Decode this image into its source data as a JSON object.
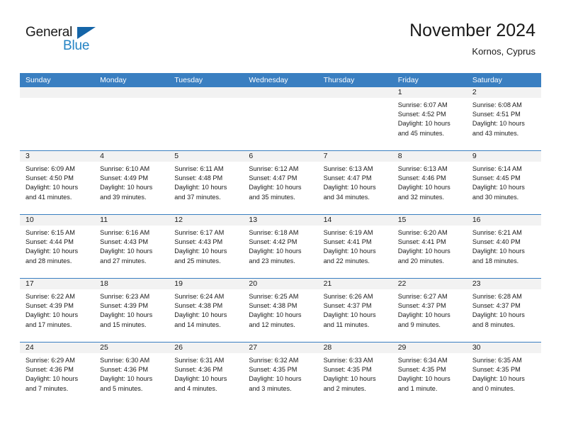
{
  "brand": {
    "name_part1": "General",
    "name_part2": "Blue",
    "accent_color": "#2383c4",
    "triangle_color": "#1565a8"
  },
  "header": {
    "title": "November 2024",
    "subtitle": "Kornos, Cyprus"
  },
  "theme": {
    "header_blue": "#3a7fc1",
    "number_band": "#f2f2f2",
    "text": "#1a1a1a"
  },
  "calendar": {
    "day_headers": [
      "Sunday",
      "Monday",
      "Tuesday",
      "Wednesday",
      "Thursday",
      "Friday",
      "Saturday"
    ],
    "weeks": [
      {
        "days": [
          {
            "number": "",
            "sunrise": "",
            "sunset": "",
            "daylight_line1": "",
            "daylight_line2": ""
          },
          {
            "number": "",
            "sunrise": "",
            "sunset": "",
            "daylight_line1": "",
            "daylight_line2": ""
          },
          {
            "number": "",
            "sunrise": "",
            "sunset": "",
            "daylight_line1": "",
            "daylight_line2": ""
          },
          {
            "number": "",
            "sunrise": "",
            "sunset": "",
            "daylight_line1": "",
            "daylight_line2": ""
          },
          {
            "number": "",
            "sunrise": "",
            "sunset": "",
            "daylight_line1": "",
            "daylight_line2": ""
          },
          {
            "number": "1",
            "sunrise": "Sunrise: 6:07 AM",
            "sunset": "Sunset: 4:52 PM",
            "daylight_line1": "Daylight: 10 hours",
            "daylight_line2": "and 45 minutes."
          },
          {
            "number": "2",
            "sunrise": "Sunrise: 6:08 AM",
            "sunset": "Sunset: 4:51 PM",
            "daylight_line1": "Daylight: 10 hours",
            "daylight_line2": "and 43 minutes."
          }
        ]
      },
      {
        "days": [
          {
            "number": "3",
            "sunrise": "Sunrise: 6:09 AM",
            "sunset": "Sunset: 4:50 PM",
            "daylight_line1": "Daylight: 10 hours",
            "daylight_line2": "and 41 minutes."
          },
          {
            "number": "4",
            "sunrise": "Sunrise: 6:10 AM",
            "sunset": "Sunset: 4:49 PM",
            "daylight_line1": "Daylight: 10 hours",
            "daylight_line2": "and 39 minutes."
          },
          {
            "number": "5",
            "sunrise": "Sunrise: 6:11 AM",
            "sunset": "Sunset: 4:48 PM",
            "daylight_line1": "Daylight: 10 hours",
            "daylight_line2": "and 37 minutes."
          },
          {
            "number": "6",
            "sunrise": "Sunrise: 6:12 AM",
            "sunset": "Sunset: 4:47 PM",
            "daylight_line1": "Daylight: 10 hours",
            "daylight_line2": "and 35 minutes."
          },
          {
            "number": "7",
            "sunrise": "Sunrise: 6:13 AM",
            "sunset": "Sunset: 4:47 PM",
            "daylight_line1": "Daylight: 10 hours",
            "daylight_line2": "and 34 minutes."
          },
          {
            "number": "8",
            "sunrise": "Sunrise: 6:13 AM",
            "sunset": "Sunset: 4:46 PM",
            "daylight_line1": "Daylight: 10 hours",
            "daylight_line2": "and 32 minutes."
          },
          {
            "number": "9",
            "sunrise": "Sunrise: 6:14 AM",
            "sunset": "Sunset: 4:45 PM",
            "daylight_line1": "Daylight: 10 hours",
            "daylight_line2": "and 30 minutes."
          }
        ]
      },
      {
        "days": [
          {
            "number": "10",
            "sunrise": "Sunrise: 6:15 AM",
            "sunset": "Sunset: 4:44 PM",
            "daylight_line1": "Daylight: 10 hours",
            "daylight_line2": "and 28 minutes."
          },
          {
            "number": "11",
            "sunrise": "Sunrise: 6:16 AM",
            "sunset": "Sunset: 4:43 PM",
            "daylight_line1": "Daylight: 10 hours",
            "daylight_line2": "and 27 minutes."
          },
          {
            "number": "12",
            "sunrise": "Sunrise: 6:17 AM",
            "sunset": "Sunset: 4:43 PM",
            "daylight_line1": "Daylight: 10 hours",
            "daylight_line2": "and 25 minutes."
          },
          {
            "number": "13",
            "sunrise": "Sunrise: 6:18 AM",
            "sunset": "Sunset: 4:42 PM",
            "daylight_line1": "Daylight: 10 hours",
            "daylight_line2": "and 23 minutes."
          },
          {
            "number": "14",
            "sunrise": "Sunrise: 6:19 AM",
            "sunset": "Sunset: 4:41 PM",
            "daylight_line1": "Daylight: 10 hours",
            "daylight_line2": "and 22 minutes."
          },
          {
            "number": "15",
            "sunrise": "Sunrise: 6:20 AM",
            "sunset": "Sunset: 4:41 PM",
            "daylight_line1": "Daylight: 10 hours",
            "daylight_line2": "and 20 minutes."
          },
          {
            "number": "16",
            "sunrise": "Sunrise: 6:21 AM",
            "sunset": "Sunset: 4:40 PM",
            "daylight_line1": "Daylight: 10 hours",
            "daylight_line2": "and 18 minutes."
          }
        ]
      },
      {
        "days": [
          {
            "number": "17",
            "sunrise": "Sunrise: 6:22 AM",
            "sunset": "Sunset: 4:39 PM",
            "daylight_line1": "Daylight: 10 hours",
            "daylight_line2": "and 17 minutes."
          },
          {
            "number": "18",
            "sunrise": "Sunrise: 6:23 AM",
            "sunset": "Sunset: 4:39 PM",
            "daylight_line1": "Daylight: 10 hours",
            "daylight_line2": "and 15 minutes."
          },
          {
            "number": "19",
            "sunrise": "Sunrise: 6:24 AM",
            "sunset": "Sunset: 4:38 PM",
            "daylight_line1": "Daylight: 10 hours",
            "daylight_line2": "and 14 minutes."
          },
          {
            "number": "20",
            "sunrise": "Sunrise: 6:25 AM",
            "sunset": "Sunset: 4:38 PM",
            "daylight_line1": "Daylight: 10 hours",
            "daylight_line2": "and 12 minutes."
          },
          {
            "number": "21",
            "sunrise": "Sunrise: 6:26 AM",
            "sunset": "Sunset: 4:37 PM",
            "daylight_line1": "Daylight: 10 hours",
            "daylight_line2": "and 11 minutes."
          },
          {
            "number": "22",
            "sunrise": "Sunrise: 6:27 AM",
            "sunset": "Sunset: 4:37 PM",
            "daylight_line1": "Daylight: 10 hours",
            "daylight_line2": "and 9 minutes."
          },
          {
            "number": "23",
            "sunrise": "Sunrise: 6:28 AM",
            "sunset": "Sunset: 4:37 PM",
            "daylight_line1": "Daylight: 10 hours",
            "daylight_line2": "and 8 minutes."
          }
        ]
      },
      {
        "days": [
          {
            "number": "24",
            "sunrise": "Sunrise: 6:29 AM",
            "sunset": "Sunset: 4:36 PM",
            "daylight_line1": "Daylight: 10 hours",
            "daylight_line2": "and 7 minutes."
          },
          {
            "number": "25",
            "sunrise": "Sunrise: 6:30 AM",
            "sunset": "Sunset: 4:36 PM",
            "daylight_line1": "Daylight: 10 hours",
            "daylight_line2": "and 5 minutes."
          },
          {
            "number": "26",
            "sunrise": "Sunrise: 6:31 AM",
            "sunset": "Sunset: 4:36 PM",
            "daylight_line1": "Daylight: 10 hours",
            "daylight_line2": "and 4 minutes."
          },
          {
            "number": "27",
            "sunrise": "Sunrise: 6:32 AM",
            "sunset": "Sunset: 4:35 PM",
            "daylight_line1": "Daylight: 10 hours",
            "daylight_line2": "and 3 minutes."
          },
          {
            "number": "28",
            "sunrise": "Sunrise: 6:33 AM",
            "sunset": "Sunset: 4:35 PM",
            "daylight_line1": "Daylight: 10 hours",
            "daylight_line2": "and 2 minutes."
          },
          {
            "number": "29",
            "sunrise": "Sunrise: 6:34 AM",
            "sunset": "Sunset: 4:35 PM",
            "daylight_line1": "Daylight: 10 hours",
            "daylight_line2": "and 1 minute."
          },
          {
            "number": "30",
            "sunrise": "Sunrise: 6:35 AM",
            "sunset": "Sunset: 4:35 PM",
            "daylight_line1": "Daylight: 10 hours",
            "daylight_line2": "and 0 minutes."
          }
        ]
      }
    ]
  }
}
